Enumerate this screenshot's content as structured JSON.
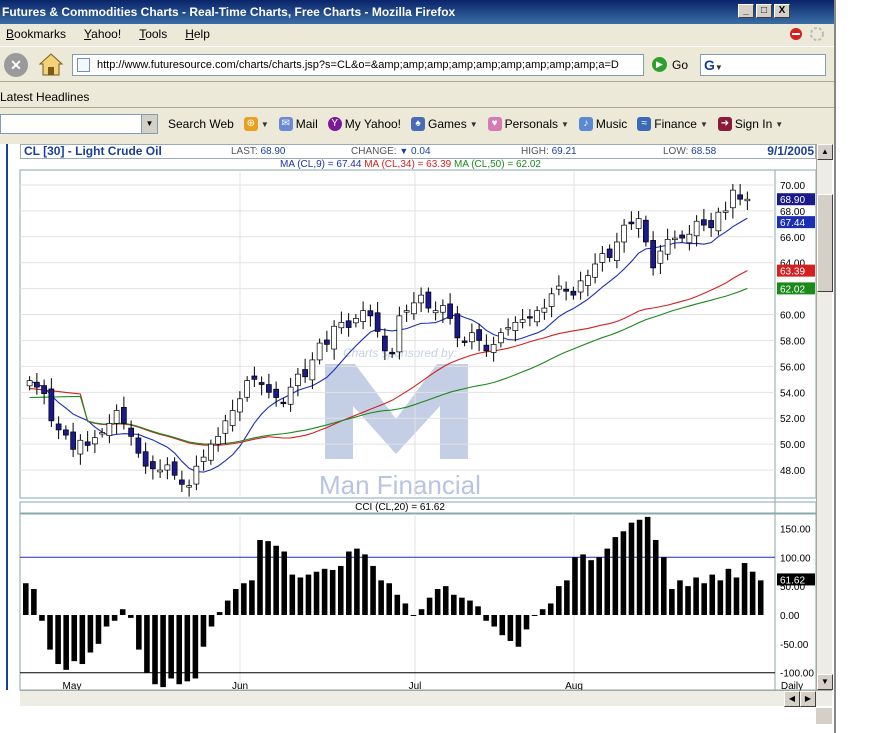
{
  "window": {
    "title": "Futures & Commodities Charts - Real-Time Charts, Free Charts - Mozilla Firefox",
    "buttons": [
      "_",
      "□",
      "X"
    ]
  },
  "menu": [
    "Bookmarks",
    "Yahoo!",
    "Tools",
    "Help"
  ],
  "nav": {
    "url": "http://www.futuresource.com/charts/charts.jsp?s=CL&o=&amp;amp;amp;amp;amp;amp;amp;amp;amp;a=D",
    "go_label": "Go",
    "search_logo": "G"
  },
  "headlines_label": "Latest Headlines",
  "yahoo_toolbar": {
    "search_web": "Search Web",
    "mail": "Mail",
    "my_yahoo": "My Yahoo!",
    "games": "Games",
    "personals": "Personals",
    "music": "Music",
    "finance": "Finance",
    "sign_in": "Sign In"
  },
  "chart_header": {
    "symbol": "CL [30] - Light Crude Oil",
    "last_label": "LAST:",
    "last": "68.90",
    "change_label": "CHANGE:",
    "change": "0.04",
    "high_label": "HIGH:",
    "high": "69.21",
    "low_label": "LOW:",
    "low": "68.58",
    "date": "9/1/2005"
  },
  "ma_legend": {
    "ma9": "MA (CL,9) = 67.44",
    "ma34": "MA (CL,34) = 63.39",
    "ma50": "MA (CL,50) = 62.02"
  },
  "colors": {
    "up_candle": "#ffffff",
    "down_candle": "#1a1a8c",
    "ma9": "#1a2fb4",
    "ma34": "#d42020",
    "ma50": "#1a8a1a",
    "cci_bar": "#000000"
  },
  "watermark": {
    "line1": "Charts sponsored by:",
    "line2": "Man Financial"
  },
  "chart_data": [
    {
      "type": "candlestick",
      "title": "CL [30] - Light Crude Oil",
      "x_ticks": [
        "May",
        "Jun",
        "Jul",
        "Aug",
        "Daily"
      ],
      "y_ticks": [
        "48.00",
        "50.00",
        "52.00",
        "54.00",
        "56.00",
        "58.00",
        "60.00",
        "62.00",
        "64.00",
        "66.00",
        "68.00",
        "70.00"
      ],
      "ylim": [
        46,
        71
      ],
      "price_labels": [
        "68.90",
        "67.44",
        "63.39",
        "62.02"
      ],
      "close": [
        54.9,
        54.4,
        53.9,
        51.8,
        51.1,
        50.7,
        49.6,
        50.3,
        49.9,
        50.5,
        50.9,
        51.6,
        52.6,
        51.6,
        50.6,
        49.3,
        48.3,
        48.1,
        48.0,
        48.4,
        47.6,
        46.9,
        46.8,
        48.3,
        49.0,
        50.0,
        50.6,
        51.8,
        52.6,
        53.5,
        54.9,
        55.0,
        54.6,
        54.0,
        53.6,
        53.2,
        54.4,
        55.4,
        55.2,
        56.5,
        57.8,
        57.7,
        59.1,
        59.4,
        59.0,
        59.7,
        60.3,
        59.9,
        58.7,
        57.2,
        57.0,
        59.9,
        60.3,
        60.9,
        61.5,
        60.5,
        60.3,
        60.7,
        59.7,
        58.2,
        57.9,
        58.6,
        58.0,
        57.2,
        57.7,
        58.6,
        59.0,
        59.4,
        59.6,
        59.8,
        60.3,
        60.5,
        61.6,
        62.2,
        61.8,
        61.5,
        62.6,
        63.0,
        63.9,
        64.7,
        64.4,
        65.6,
        66.9,
        67.0,
        67.4,
        65.6,
        63.6,
        64.9,
        65.8,
        65.9,
        65.9,
        66.2,
        67.2,
        66.9,
        66.7,
        67.9,
        68.0,
        69.6,
        68.9,
        68.9
      ],
      "ma9_end": 67.44,
      "ma34_end": 63.39,
      "ma50_end": 62.02
    },
    {
      "type": "bar",
      "title": "CCI (CL,20) = 61.62",
      "y_ticks": [
        "150.00",
        "100.00",
        "50.00",
        "0.00",
        "-50.00",
        "-100.00"
      ],
      "ylim": [
        -130,
        175
      ],
      "reference_lines": [
        100,
        -100
      ],
      "last_label": "61.62",
      "values": [
        55,
        45,
        -10,
        -60,
        -85,
        -95,
        -80,
        -85,
        -65,
        -50,
        -20,
        -10,
        10,
        -5,
        -60,
        -100,
        -120,
        -125,
        -110,
        -120,
        -115,
        -110,
        -55,
        -20,
        5,
        25,
        45,
        55,
        60,
        130,
        128,
        120,
        110,
        70,
        65,
        70,
        75,
        80,
        78,
        85,
        110,
        115,
        105,
        85,
        60,
        55,
        35,
        20,
        0,
        10,
        30,
        45,
        50,
        35,
        30,
        25,
        15,
        -10,
        -20,
        -35,
        -45,
        -55,
        -25,
        0,
        10,
        20,
        50,
        60,
        100,
        105,
        95,
        100,
        115,
        135,
        145,
        160,
        165,
        170,
        130,
        100,
        45,
        60,
        50,
        65,
        55,
        70,
        60,
        80,
        65,
        90,
        75,
        60
      ]
    }
  ]
}
